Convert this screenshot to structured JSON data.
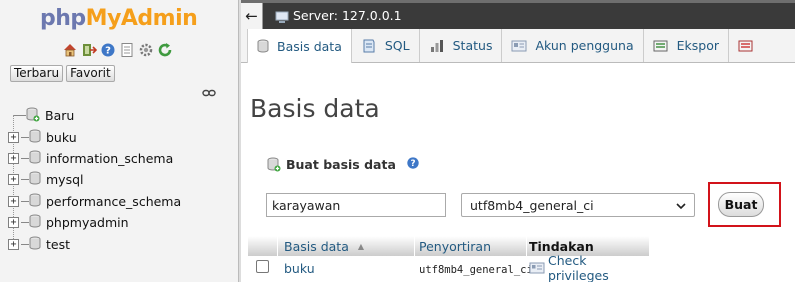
{
  "logo": {
    "part1": "php",
    "part2": "MyAdmin"
  },
  "nav": {
    "icons": [
      "home-icon",
      "exit-icon",
      "help-icon",
      "docs-icon",
      "settings-icon",
      "reload-icon"
    ],
    "recent_label": "Terbaru",
    "favorites_label": "Favorit",
    "tree": [
      {
        "label": "Baru",
        "kind": "new"
      },
      {
        "label": "buku",
        "kind": "db"
      },
      {
        "label": "information_schema",
        "kind": "db"
      },
      {
        "label": "mysql",
        "kind": "db"
      },
      {
        "label": "performance_schema",
        "kind": "db"
      },
      {
        "label": "phpmyadmin",
        "kind": "db"
      },
      {
        "label": "test",
        "kind": "db"
      }
    ]
  },
  "serverbar": {
    "label": "Server: 127.0.0.1"
  },
  "tabs": [
    {
      "label": "Basis data",
      "icon": "database-icon",
      "active": true
    },
    {
      "label": "SQL",
      "icon": "sql-icon",
      "active": false
    },
    {
      "label": "Status",
      "icon": "status-icon",
      "active": false
    },
    {
      "label": "Akun pengguna",
      "icon": "users-icon",
      "active": false
    },
    {
      "label": "Ekspor",
      "icon": "export-icon",
      "active": false
    }
  ],
  "main": {
    "title": "Basis data",
    "create_legend": "Buat basis data",
    "db_name_value": "karayawan",
    "collation_value": "utf8mb4_general_ci",
    "create_button": "Buat"
  },
  "table": {
    "headers": {
      "name": "Basis data",
      "collation": "Penyortiran",
      "actions": "Tindakan"
    },
    "rows": [
      {
        "name": "buku",
        "collation": "utf8mb4_general_ci",
        "action": "Check privileges"
      }
    ]
  },
  "colors": {
    "link": "#235a81",
    "highlight": "#d2131a",
    "serverbar": "#3a3a3a",
    "logo_php": "#6c78af",
    "logo_myadmin": "#f59f1b"
  }
}
